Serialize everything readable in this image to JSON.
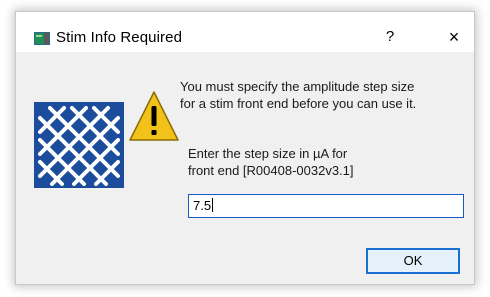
{
  "window": {
    "title": "Stim Info Required",
    "help_label": "?",
    "close_label": "×",
    "app_icon": "app-window-icon"
  },
  "body": {
    "logo_icon": "blackrock-logo-icon",
    "warning_icon": "warning-icon",
    "message": "You must specify the amplitude step size\nfor a stim front end before you can use it.",
    "prompt": "Enter the step size in µA for\nfront end [R00408-0032v3.1]",
    "input_value": "7.5"
  },
  "buttons": {
    "ok_label": "OK"
  },
  "colors": {
    "logo_blue": "#1c4d9c",
    "warning_yellow": "#f3c21a",
    "focus_border": "#1a5ac4",
    "ok_border": "#1a6fd3"
  }
}
